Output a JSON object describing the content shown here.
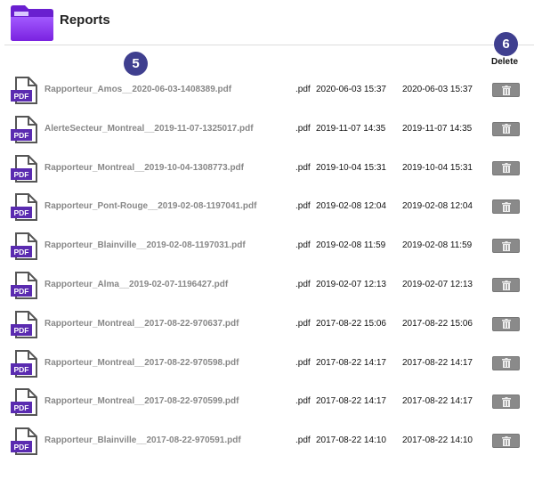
{
  "header": {
    "title": "Reports",
    "folder_color": "#8b3ff0"
  },
  "badges": {
    "left": "5",
    "right": "6",
    "color": "#3f3f8f"
  },
  "columns": {
    "delete": "Delete"
  },
  "pdf_icon_label": "PDF",
  "rows": [
    {
      "name": "Rapporteur_Amos__2020-06-03-1408389.pdf",
      "ext": ".pdf",
      "created": "2020-06-03 15:37",
      "modified": "2020-06-03 15:37"
    },
    {
      "name": "AlerteSecteur_Montreal__2019-11-07-1325017.pdf",
      "ext": ".pdf",
      "created": "2019-11-07 14:35",
      "modified": "2019-11-07 14:35"
    },
    {
      "name": "Rapporteur_Montreal__2019-10-04-1308773.pdf",
      "ext": ".pdf",
      "created": "2019-10-04 15:31",
      "modified": "2019-10-04 15:31"
    },
    {
      "name": "Rapporteur_Pont-Rouge__2019-02-08-1197041.pdf",
      "ext": ".pdf",
      "created": "2019-02-08 12:04",
      "modified": "2019-02-08 12:04"
    },
    {
      "name": "Rapporteur_Blainville__2019-02-08-1197031.pdf",
      "ext": ".pdf",
      "created": "2019-02-08 11:59",
      "modified": "2019-02-08 11:59"
    },
    {
      "name": "Rapporteur_Alma__2019-02-07-1196427.pdf",
      "ext": ".pdf",
      "created": "2019-02-07 12:13",
      "modified": "2019-02-07 12:13"
    },
    {
      "name": "Rapporteur_Montreal__2017-08-22-970637.pdf",
      "ext": ".pdf",
      "created": "2017-08-22 15:06",
      "modified": "2017-08-22 15:06"
    },
    {
      "name": "Rapporteur_Montreal__2017-08-22-970598.pdf",
      "ext": ".pdf",
      "created": "2017-08-22 14:17",
      "modified": "2017-08-22 14:17"
    },
    {
      "name": "Rapporteur_Montreal__2017-08-22-970599.pdf",
      "ext": ".pdf",
      "created": "2017-08-22 14:17",
      "modified": "2017-08-22 14:17"
    },
    {
      "name": "Rapporteur_Blainville__2017-08-22-970591.pdf",
      "ext": ".pdf",
      "created": "2017-08-22 14:10",
      "modified": "2017-08-22 14:10"
    }
  ]
}
